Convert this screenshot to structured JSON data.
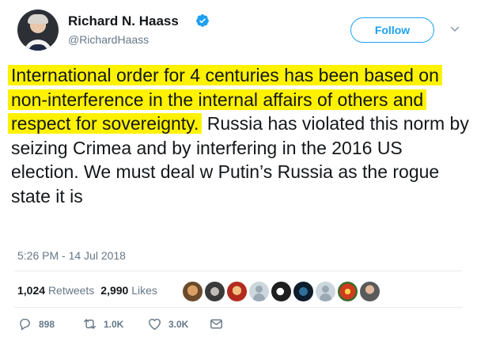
{
  "user": {
    "display_name": "Richard N. Haass",
    "handle": "@RichardHaass",
    "verified_icon": "verified-badge-icon"
  },
  "follow_label": "Follow",
  "tweet": {
    "highlighted_text": "International order for 4 centuries has been based on non-interference in the internal affairs of others and respect for sovereignty.",
    "text": "Russia has violated this norm by seizing Crimea and by interfering in the 2016 US election. We must deal w Putin’s Russia as the rogue state it is",
    "highlight_color": "#fff200"
  },
  "timestamp": "5:26 PM - 14 Jul 2018",
  "stats": {
    "retweets_count": "1,024",
    "retweets_label": "Retweets",
    "likes_count": "2,990",
    "likes_label": "Likes"
  },
  "actions": {
    "reply_count": "898",
    "retweet_count": "1.0K",
    "like_count": "3.0K"
  },
  "colors": {
    "accent": "#1da1f2",
    "secondary_text": "#657786",
    "primary_text": "#14171a"
  }
}
